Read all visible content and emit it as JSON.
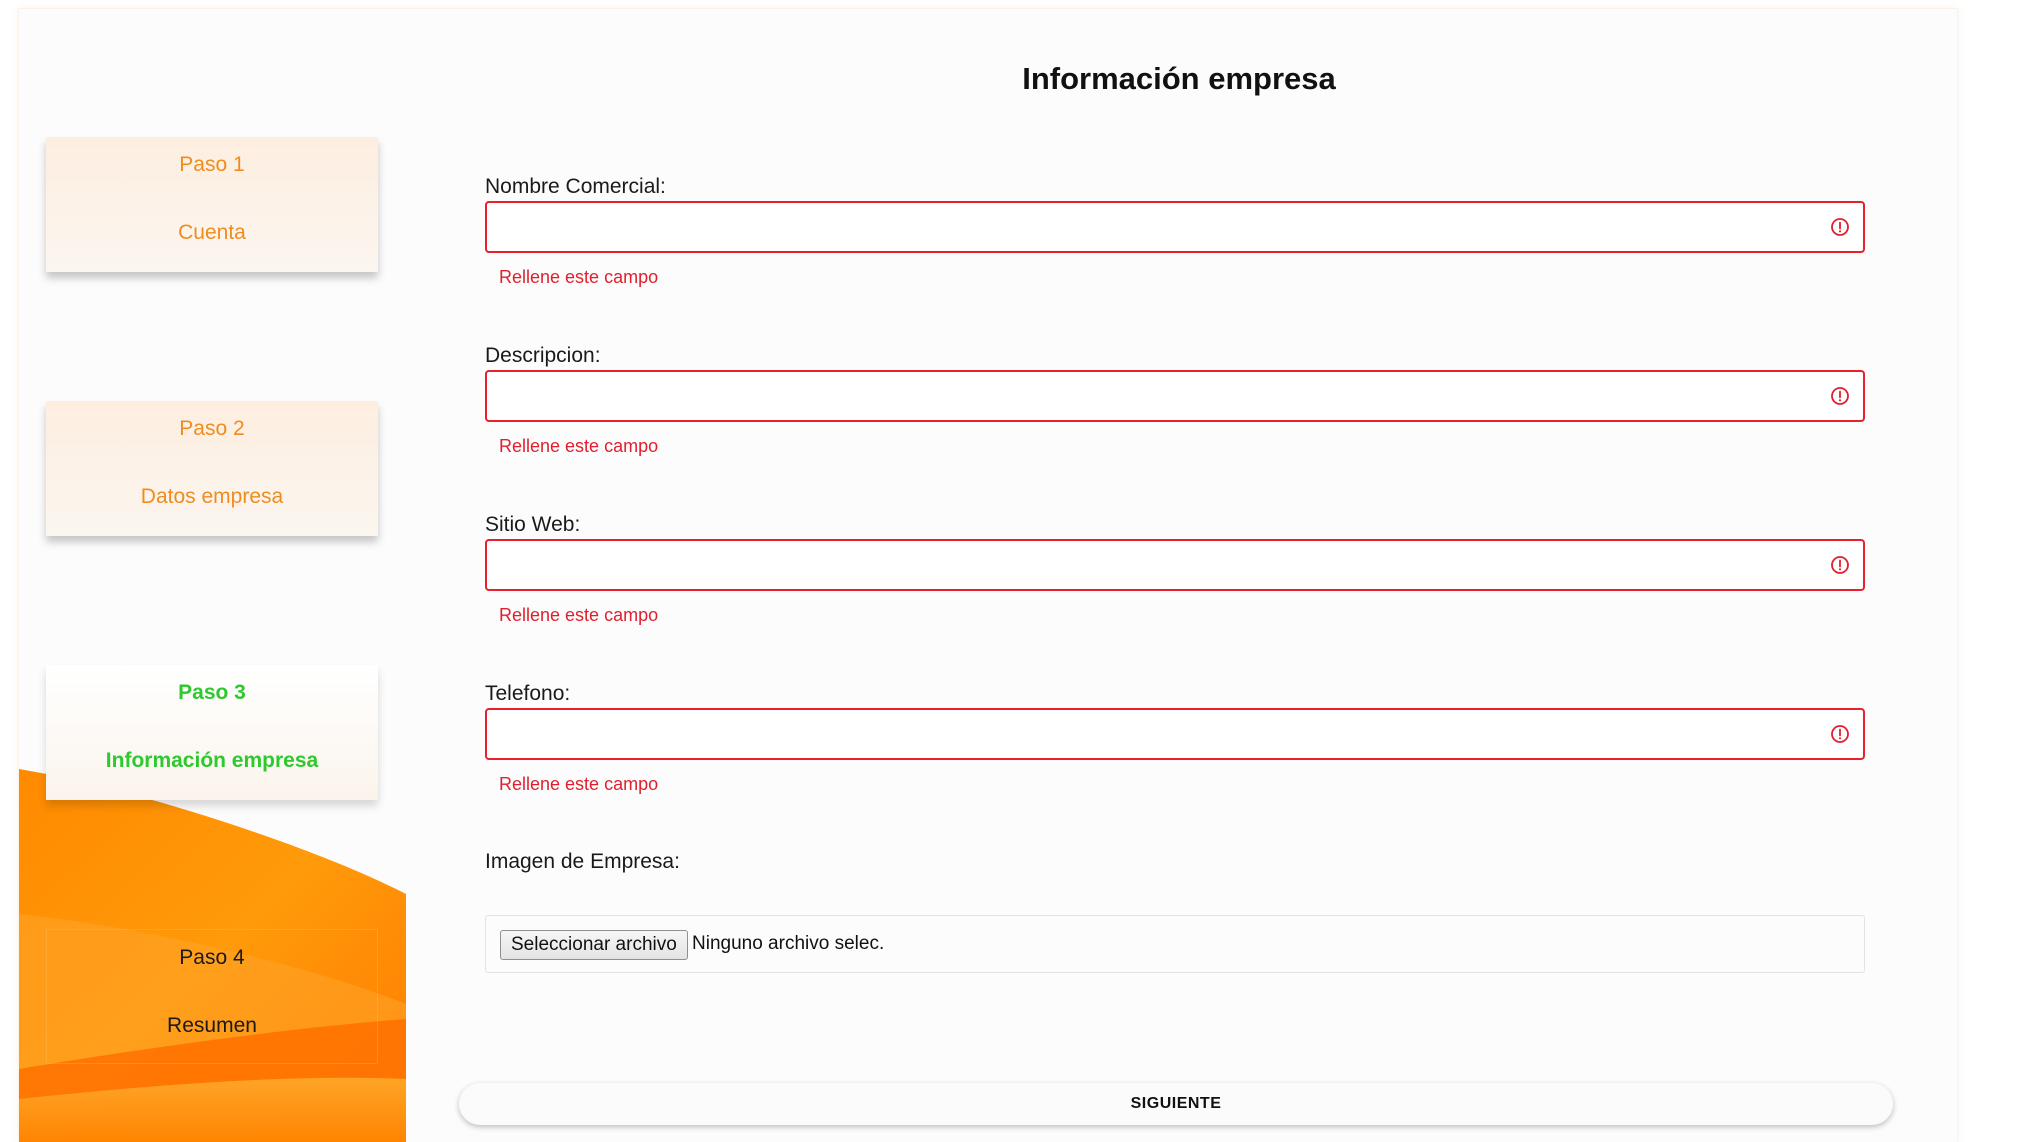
{
  "sidebar": {
    "steps": [
      {
        "num": "Paso 1",
        "name": "Cuenta",
        "state": "completed"
      },
      {
        "num": "Paso 2",
        "name": "Datos empresa",
        "state": "completed"
      },
      {
        "num": "Paso 3",
        "name": "Información empresa",
        "state": "current"
      },
      {
        "num": "Paso 4",
        "name": "Resumen",
        "state": "upcoming"
      }
    ]
  },
  "form": {
    "title": "Información empresa",
    "fields": [
      {
        "label": "Nombre Comercial:",
        "value": "",
        "error": "Rellene este campo",
        "icon": "alert-circle-icon"
      },
      {
        "label": "Descripcion:",
        "value": "",
        "error": "Rellene este campo",
        "icon": "alert-circle-icon"
      },
      {
        "label": "Sitio Web:",
        "value": "",
        "error": "Rellene este campo",
        "icon": "alert-circle-icon"
      },
      {
        "label": "Telefono:",
        "value": "",
        "error": "Rellene este campo",
        "icon": "alert-circle-icon"
      }
    ],
    "image": {
      "label": "Imagen de Empresa:",
      "button_label": "Seleccionar archivo",
      "status": "Ninguno archivo selec."
    },
    "submit_label": "SIGUIENTE"
  },
  "colors": {
    "step_pending_text": "#f08c1e",
    "step_current_text": "#2ec92e",
    "error": "#e0202e",
    "sidebar_accent": "#ff8c00"
  }
}
